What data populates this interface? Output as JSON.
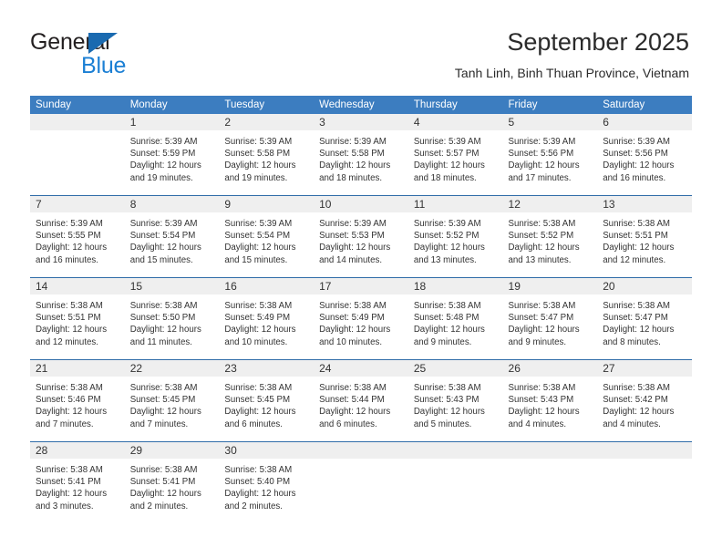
{
  "brand": {
    "name_part1": "General",
    "name_part2": "Blue"
  },
  "header": {
    "title": "September 2025",
    "subtitle": "Tanh Linh, Binh Thuan Province, Vietnam"
  },
  "weekdays": [
    "Sunday",
    "Monday",
    "Tuesday",
    "Wednesday",
    "Thursday",
    "Friday",
    "Saturday"
  ],
  "colors": {
    "header_blue": "#3c7dc0",
    "row_divider_blue": "#2f6ca8",
    "day_band_gray": "#efefef",
    "brand_blue": "#1b7fd4",
    "text": "#333333"
  },
  "weeks": [
    [
      {
        "day": "",
        "empty": true,
        "sunrise": "",
        "sunset": "",
        "daylight_line1": "",
        "daylight_line2": ""
      },
      {
        "day": "1",
        "empty": false,
        "sunrise": "Sunrise: 5:39 AM",
        "sunset": "Sunset: 5:59 PM",
        "daylight_line1": "Daylight: 12 hours",
        "daylight_line2": "and 19 minutes."
      },
      {
        "day": "2",
        "empty": false,
        "sunrise": "Sunrise: 5:39 AM",
        "sunset": "Sunset: 5:58 PM",
        "daylight_line1": "Daylight: 12 hours",
        "daylight_line2": "and 19 minutes."
      },
      {
        "day": "3",
        "empty": false,
        "sunrise": "Sunrise: 5:39 AM",
        "sunset": "Sunset: 5:58 PM",
        "daylight_line1": "Daylight: 12 hours",
        "daylight_line2": "and 18 minutes."
      },
      {
        "day": "4",
        "empty": false,
        "sunrise": "Sunrise: 5:39 AM",
        "sunset": "Sunset: 5:57 PM",
        "daylight_line1": "Daylight: 12 hours",
        "daylight_line2": "and 18 minutes."
      },
      {
        "day": "5",
        "empty": false,
        "sunrise": "Sunrise: 5:39 AM",
        "sunset": "Sunset: 5:56 PM",
        "daylight_line1": "Daylight: 12 hours",
        "daylight_line2": "and 17 minutes."
      },
      {
        "day": "6",
        "empty": false,
        "sunrise": "Sunrise: 5:39 AM",
        "sunset": "Sunset: 5:56 PM",
        "daylight_line1": "Daylight: 12 hours",
        "daylight_line2": "and 16 minutes."
      }
    ],
    [
      {
        "day": "7",
        "empty": false,
        "sunrise": "Sunrise: 5:39 AM",
        "sunset": "Sunset: 5:55 PM",
        "daylight_line1": "Daylight: 12 hours",
        "daylight_line2": "and 16 minutes."
      },
      {
        "day": "8",
        "empty": false,
        "sunrise": "Sunrise: 5:39 AM",
        "sunset": "Sunset: 5:54 PM",
        "daylight_line1": "Daylight: 12 hours",
        "daylight_line2": "and 15 minutes."
      },
      {
        "day": "9",
        "empty": false,
        "sunrise": "Sunrise: 5:39 AM",
        "sunset": "Sunset: 5:54 PM",
        "daylight_line1": "Daylight: 12 hours",
        "daylight_line2": "and 15 minutes."
      },
      {
        "day": "10",
        "empty": false,
        "sunrise": "Sunrise: 5:39 AM",
        "sunset": "Sunset: 5:53 PM",
        "daylight_line1": "Daylight: 12 hours",
        "daylight_line2": "and 14 minutes."
      },
      {
        "day": "11",
        "empty": false,
        "sunrise": "Sunrise: 5:39 AM",
        "sunset": "Sunset: 5:52 PM",
        "daylight_line1": "Daylight: 12 hours",
        "daylight_line2": "and 13 minutes."
      },
      {
        "day": "12",
        "empty": false,
        "sunrise": "Sunrise: 5:38 AM",
        "sunset": "Sunset: 5:52 PM",
        "daylight_line1": "Daylight: 12 hours",
        "daylight_line2": "and 13 minutes."
      },
      {
        "day": "13",
        "empty": false,
        "sunrise": "Sunrise: 5:38 AM",
        "sunset": "Sunset: 5:51 PM",
        "daylight_line1": "Daylight: 12 hours",
        "daylight_line2": "and 12 minutes."
      }
    ],
    [
      {
        "day": "14",
        "empty": false,
        "sunrise": "Sunrise: 5:38 AM",
        "sunset": "Sunset: 5:51 PM",
        "daylight_line1": "Daylight: 12 hours",
        "daylight_line2": "and 12 minutes."
      },
      {
        "day": "15",
        "empty": false,
        "sunrise": "Sunrise: 5:38 AM",
        "sunset": "Sunset: 5:50 PM",
        "daylight_line1": "Daylight: 12 hours",
        "daylight_line2": "and 11 minutes."
      },
      {
        "day": "16",
        "empty": false,
        "sunrise": "Sunrise: 5:38 AM",
        "sunset": "Sunset: 5:49 PM",
        "daylight_line1": "Daylight: 12 hours",
        "daylight_line2": "and 10 minutes."
      },
      {
        "day": "17",
        "empty": false,
        "sunrise": "Sunrise: 5:38 AM",
        "sunset": "Sunset: 5:49 PM",
        "daylight_line1": "Daylight: 12 hours",
        "daylight_line2": "and 10 minutes."
      },
      {
        "day": "18",
        "empty": false,
        "sunrise": "Sunrise: 5:38 AM",
        "sunset": "Sunset: 5:48 PM",
        "daylight_line1": "Daylight: 12 hours",
        "daylight_line2": "and 9 minutes."
      },
      {
        "day": "19",
        "empty": false,
        "sunrise": "Sunrise: 5:38 AM",
        "sunset": "Sunset: 5:47 PM",
        "daylight_line1": "Daylight: 12 hours",
        "daylight_line2": "and 9 minutes."
      },
      {
        "day": "20",
        "empty": false,
        "sunrise": "Sunrise: 5:38 AM",
        "sunset": "Sunset: 5:47 PM",
        "daylight_line1": "Daylight: 12 hours",
        "daylight_line2": "and 8 minutes."
      }
    ],
    [
      {
        "day": "21",
        "empty": false,
        "sunrise": "Sunrise: 5:38 AM",
        "sunset": "Sunset: 5:46 PM",
        "daylight_line1": "Daylight: 12 hours",
        "daylight_line2": "and 7 minutes."
      },
      {
        "day": "22",
        "empty": false,
        "sunrise": "Sunrise: 5:38 AM",
        "sunset": "Sunset: 5:45 PM",
        "daylight_line1": "Daylight: 12 hours",
        "daylight_line2": "and 7 minutes."
      },
      {
        "day": "23",
        "empty": false,
        "sunrise": "Sunrise: 5:38 AM",
        "sunset": "Sunset: 5:45 PM",
        "daylight_line1": "Daylight: 12 hours",
        "daylight_line2": "and 6 minutes."
      },
      {
        "day": "24",
        "empty": false,
        "sunrise": "Sunrise: 5:38 AM",
        "sunset": "Sunset: 5:44 PM",
        "daylight_line1": "Daylight: 12 hours",
        "daylight_line2": "and 6 minutes."
      },
      {
        "day": "25",
        "empty": false,
        "sunrise": "Sunrise: 5:38 AM",
        "sunset": "Sunset: 5:43 PM",
        "daylight_line1": "Daylight: 12 hours",
        "daylight_line2": "and 5 minutes."
      },
      {
        "day": "26",
        "empty": false,
        "sunrise": "Sunrise: 5:38 AM",
        "sunset": "Sunset: 5:43 PM",
        "daylight_line1": "Daylight: 12 hours",
        "daylight_line2": "and 4 minutes."
      },
      {
        "day": "27",
        "empty": false,
        "sunrise": "Sunrise: 5:38 AM",
        "sunset": "Sunset: 5:42 PM",
        "daylight_line1": "Daylight: 12 hours",
        "daylight_line2": "and 4 minutes."
      }
    ],
    [
      {
        "day": "28",
        "empty": false,
        "sunrise": "Sunrise: 5:38 AM",
        "sunset": "Sunset: 5:41 PM",
        "daylight_line1": "Daylight: 12 hours",
        "daylight_line2": "and 3 minutes."
      },
      {
        "day": "29",
        "empty": false,
        "sunrise": "Sunrise: 5:38 AM",
        "sunset": "Sunset: 5:41 PM",
        "daylight_line1": "Daylight: 12 hours",
        "daylight_line2": "and 2 minutes."
      },
      {
        "day": "30",
        "empty": false,
        "sunrise": "Sunrise: 5:38 AM",
        "sunset": "Sunset: 5:40 PM",
        "daylight_line1": "Daylight: 12 hours",
        "daylight_line2": "and 2 minutes."
      },
      {
        "day": "",
        "empty": true,
        "sunrise": "",
        "sunset": "",
        "daylight_line1": "",
        "daylight_line2": ""
      },
      {
        "day": "",
        "empty": true,
        "sunrise": "",
        "sunset": "",
        "daylight_line1": "",
        "daylight_line2": ""
      },
      {
        "day": "",
        "empty": true,
        "sunrise": "",
        "sunset": "",
        "daylight_line1": "",
        "daylight_line2": ""
      },
      {
        "day": "",
        "empty": true,
        "sunrise": "",
        "sunset": "",
        "daylight_line1": "",
        "daylight_line2": ""
      }
    ]
  ]
}
